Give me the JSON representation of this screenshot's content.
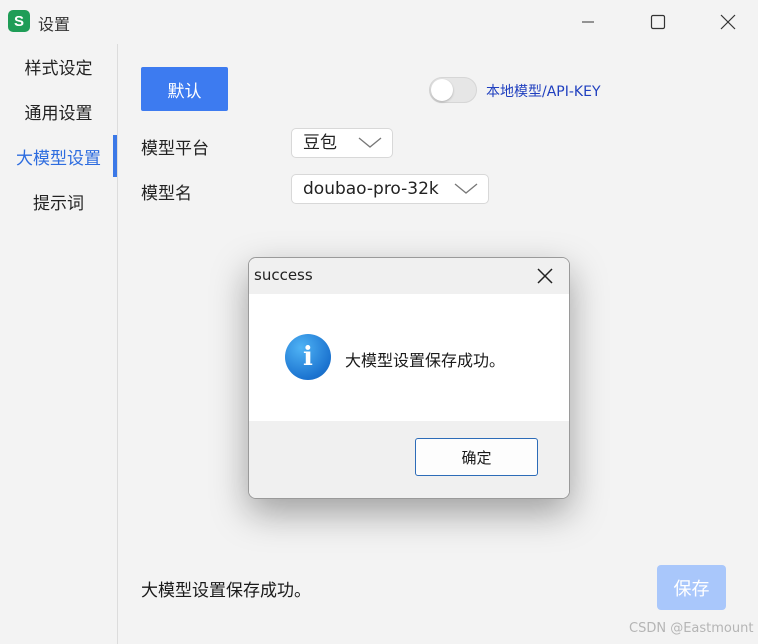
{
  "window": {
    "title": "设置",
    "app_icon_letter": "S"
  },
  "sidebar": {
    "items": [
      {
        "label": "样式设定",
        "active": false
      },
      {
        "label": "通用设置",
        "active": false
      },
      {
        "label": "大模型设置",
        "active": true
      },
      {
        "label": "提示词",
        "active": false
      }
    ]
  },
  "main": {
    "default_button": "默认",
    "toggle": {
      "label": "本地模型/API-KEY",
      "on": false
    },
    "platform": {
      "label": "模型平台",
      "value": "豆包"
    },
    "model": {
      "label": "模型名",
      "value": "doubao-pro-32k"
    },
    "status_text": "大模型设置保存成功。",
    "save_button": "保存"
  },
  "dialog": {
    "title": "success",
    "message": "大模型设置保存成功。",
    "ok_button": "确定",
    "icon": "info-icon"
  },
  "watermark": "CSDN @Eastmount",
  "colors": {
    "accent": "#3d7bf0",
    "active_text": "#2d6cdf",
    "save_disabled": "#a9c7fb",
    "toggle_label": "#1f3fbf"
  }
}
